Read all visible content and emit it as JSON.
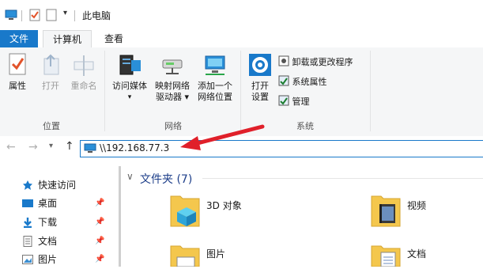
{
  "window": {
    "title": "此电脑"
  },
  "ribbon_tabs": {
    "file": "文件",
    "computer": "计算机",
    "view": "查看"
  },
  "ribbon": {
    "location": {
      "label": "位置",
      "properties": "属性",
      "open": "打开",
      "rename": "重命名"
    },
    "network": {
      "label": "网络",
      "access_media": "访问媒体",
      "map_drive_line1": "映射网络",
      "map_drive_line2": "驱动器",
      "add_location_line1": "添加一个",
      "add_location_line2": "网络位置"
    },
    "system": {
      "label": "系统",
      "open_settings_line1": "打开",
      "open_settings_line2": "设置",
      "uninstall": "卸载或更改程序",
      "system_properties": "系统属性",
      "manage": "管理"
    }
  },
  "address_bar": {
    "value": "\\\\192.168.77.3"
  },
  "sidebar": {
    "items": [
      {
        "label": "快速访问",
        "icon": "star-icon"
      },
      {
        "label": "桌面",
        "icon": "desktop-icon"
      },
      {
        "label": "下载",
        "icon": "download-icon"
      },
      {
        "label": "文档",
        "icon": "document-icon"
      },
      {
        "label": "图片",
        "icon": "picture-icon"
      }
    ]
  },
  "content": {
    "section_header": "文件夹 (7)",
    "folders": [
      {
        "label": "3D 对象"
      },
      {
        "label": "视频"
      },
      {
        "label": "图片"
      },
      {
        "label": "文档"
      }
    ]
  },
  "colors": {
    "accent": "#1979ca",
    "arrow": "#e0202a",
    "ribbon_bg": "#f5f6f7",
    "folder_yellow": "#f4c74d"
  }
}
